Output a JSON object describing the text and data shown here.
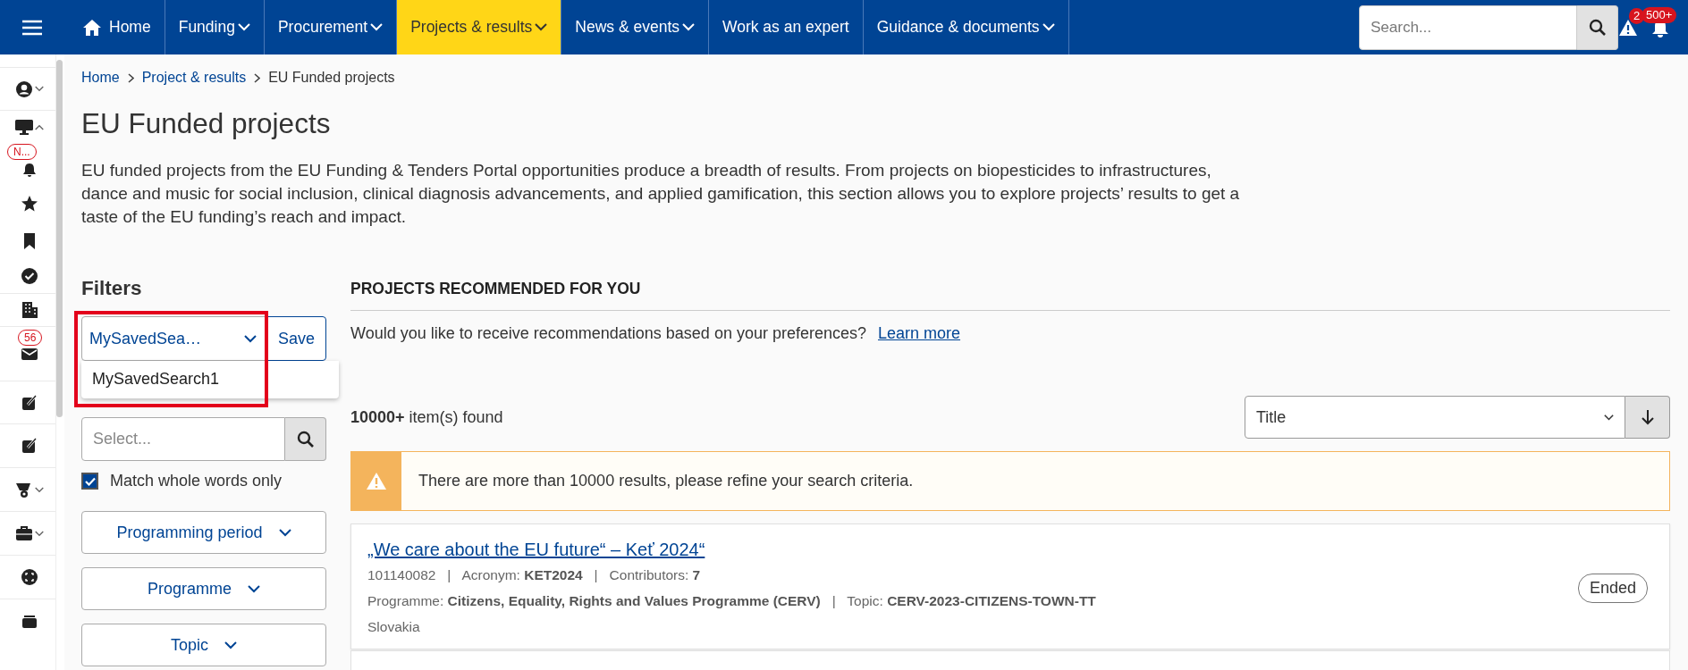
{
  "nav": {
    "items": [
      {
        "label": "Home",
        "kind": "home",
        "selected": false
      },
      {
        "label": "Funding",
        "kind": "menu",
        "selected": false
      },
      {
        "label": "Procurement",
        "kind": "menu",
        "selected": false
      },
      {
        "label": "Projects & results",
        "kind": "menu",
        "selected": true
      },
      {
        "label": "News & events",
        "kind": "menu",
        "selected": false
      },
      {
        "label": "Work as an expert",
        "kind": "link",
        "selected": false
      },
      {
        "label": "Guidance & documents",
        "kind": "menu",
        "selected": false
      }
    ],
    "search": {
      "placeholder": "Search..."
    },
    "alerts_badge": "2",
    "notifications_badge": "500+"
  },
  "sidebar": {
    "items": [
      {
        "kind": "menu",
        "expanded": false
      },
      {
        "kind": "menu",
        "expanded": true
      },
      {
        "kind": "link",
        "badge": "N..."
      },
      {
        "kind": "link"
      },
      {
        "kind": "link"
      },
      {
        "kind": "link"
      },
      {
        "kind": "link"
      },
      {
        "kind": "link",
        "badge": "56"
      },
      {
        "kind": "link"
      },
      {
        "kind": "link"
      },
      {
        "kind": "menu",
        "expanded": false
      },
      {
        "kind": "menu",
        "expanded": false
      },
      {
        "kind": "link"
      },
      {
        "kind": "link"
      }
    ]
  },
  "breadcrumb": [
    "Home",
    "Project & results",
    "EU Funded projects"
  ],
  "title": "EU Funded projects",
  "intro": "EU funded projects from the EU Funding & Tenders Portal opportunities produce a breadth of results. From projects on biopesticides to infrastructures, dance and music for social inclusion, clinical diagnosis advancements, and applied gamification, this section allows you to explore projects’ results to get a taste of the EU funding’s reach and impact.",
  "filters": {
    "heading": "Filters",
    "saved_search": {
      "value": "MySavedSea…",
      "expanded": true,
      "options": [
        "MySavedSearch1"
      ]
    },
    "save_button": "Save",
    "quick_search": {
      "placeholder": "Select..."
    },
    "match_whole_words": {
      "label": "Match whole words only",
      "checked": true
    },
    "facets": [
      "Programming period",
      "Programme",
      "Topic"
    ]
  },
  "recommended": {
    "heading": "PROJECTS RECOMMENDED FOR YOU",
    "question": "Would you like to receive recommendations based on your preferences?",
    "link": "Learn more"
  },
  "results": {
    "count": "**10000+** item(s) found",
    "sort": "Title",
    "warning": "There are more than 10000 results, please refine your search criteria.",
    "items": [
      {
        "title": "„We care about the EU future“ – Keť 2024“",
        "meta": "101140082   |   Acronym: **KET2024**   |   Contributors: **7**",
        "programme": "Programme: **Citizens, Equality, Rights and Values Programme (CERV)**   |   Topic: **CERV-2023-CITIZENS-TOWN-TT**",
        "country": "Slovakia",
        "status": "Ended"
      }
    ]
  }
}
